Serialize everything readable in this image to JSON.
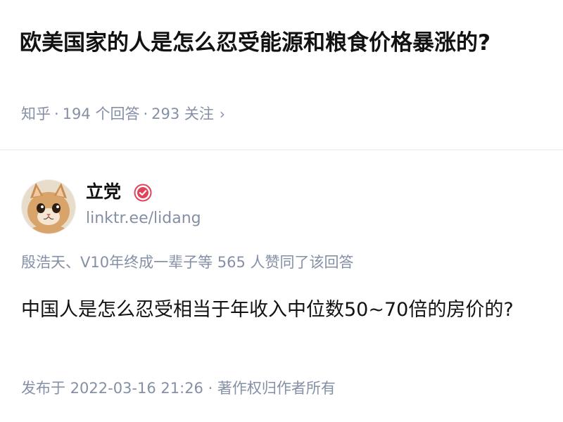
{
  "question": {
    "title": "欧美国家的人是怎么忍受能源和粮食价格暴涨的?",
    "source": "知乎",
    "answers_count": "194 个回答",
    "followers_count": "293 关注",
    "separator": "·",
    "chevron": "›"
  },
  "author": {
    "name": "立党",
    "link": "linktr.ee/lidang",
    "avatar_icon": "cat-avatar",
    "badge_icon": "verified-badge-icon",
    "badge_color": "#e2435a"
  },
  "answer": {
    "voters_text": "殷浩天、V10年终成一辈子等 565 人赞同了该回答",
    "body": "中国人是怎么忍受相当于年收入中位数50~70倍的房价的?",
    "footer": "发布于 2022-03-16 21:26 · 著作权归作者所有"
  },
  "colors": {
    "text_primary": "#121212",
    "text_secondary": "#8590a6",
    "divider": "#f2f2f2"
  }
}
